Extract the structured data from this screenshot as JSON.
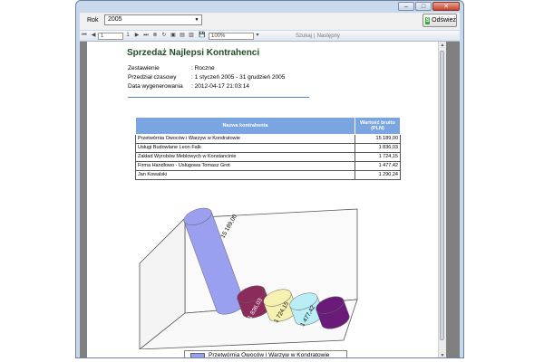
{
  "window": {
    "buttons": {
      "minimize": "–",
      "maximize": "□",
      "close": "✕"
    }
  },
  "filter": {
    "label": "Rok",
    "value": "2005",
    "refresh_label": "Odśwież"
  },
  "toolbar": {
    "page_current": "1",
    "page_total": "1",
    "zoom": "100%",
    "find_label": "Szukaj",
    "separator": "|",
    "next_label": "Następny"
  },
  "report": {
    "title": "Sprzedaż Najlepsi Kontrahenci",
    "meta": [
      {
        "key": "Zestawienie",
        "value": ": Roczne"
      },
      {
        "key": "Przedział czasowy",
        "value": ": 1 styczeń 2005 - 31 grudzień 2005"
      },
      {
        "key": "Data wygenerowania",
        "value": ": 2012-04-17 21:03:14"
      }
    ],
    "table": {
      "headers": [
        "Nazwa kontrahenta",
        "Wartość brutto\n(PLN)"
      ],
      "rows": [
        {
          "name": "Przetwórnia Owoców i Warzyw w Kondratowie",
          "value": "15 189,00"
        },
        {
          "name": "Usługi Budowlane Leon Falk",
          "value": "1 836,03"
        },
        {
          "name": "Zakład Wyrobów Meblowych w Konstancinie",
          "value": "1 724,15"
        },
        {
          "name": "Firma Handlowo - Usługowa Tomasz Grot",
          "value": "1 477,42"
        },
        {
          "name": "Jan Kowalski",
          "value": "1 290,24"
        }
      ]
    }
  },
  "chart_data": {
    "type": "bar",
    "categories": [
      "Przetwórnia Owoców i Warzyw w Kondratowie",
      "Usługi Budowlane Leon Falk",
      "Zakład Wyrobów Meblowych w Konstancinie",
      "Firma Handlowo - Usługowa Tomasz Grot",
      "Jan Kowalski"
    ],
    "values": [
      15189.0,
      1836.03,
      1724.15,
      1477.42,
      1290.24
    ],
    "data_labels": [
      "15 189,00",
      "1 836,03",
      "1 724,15",
      "1 477,42",
      ""
    ],
    "colors": [
      "#9b9ff0",
      "#8a2b5b",
      "#f6f1b0",
      "#b9eef6",
      "#6a1a78"
    ],
    "legend": [
      "Przetwórnia Owoców i Warzyw w Kondratowie"
    ],
    "legend_position": "bottom"
  }
}
